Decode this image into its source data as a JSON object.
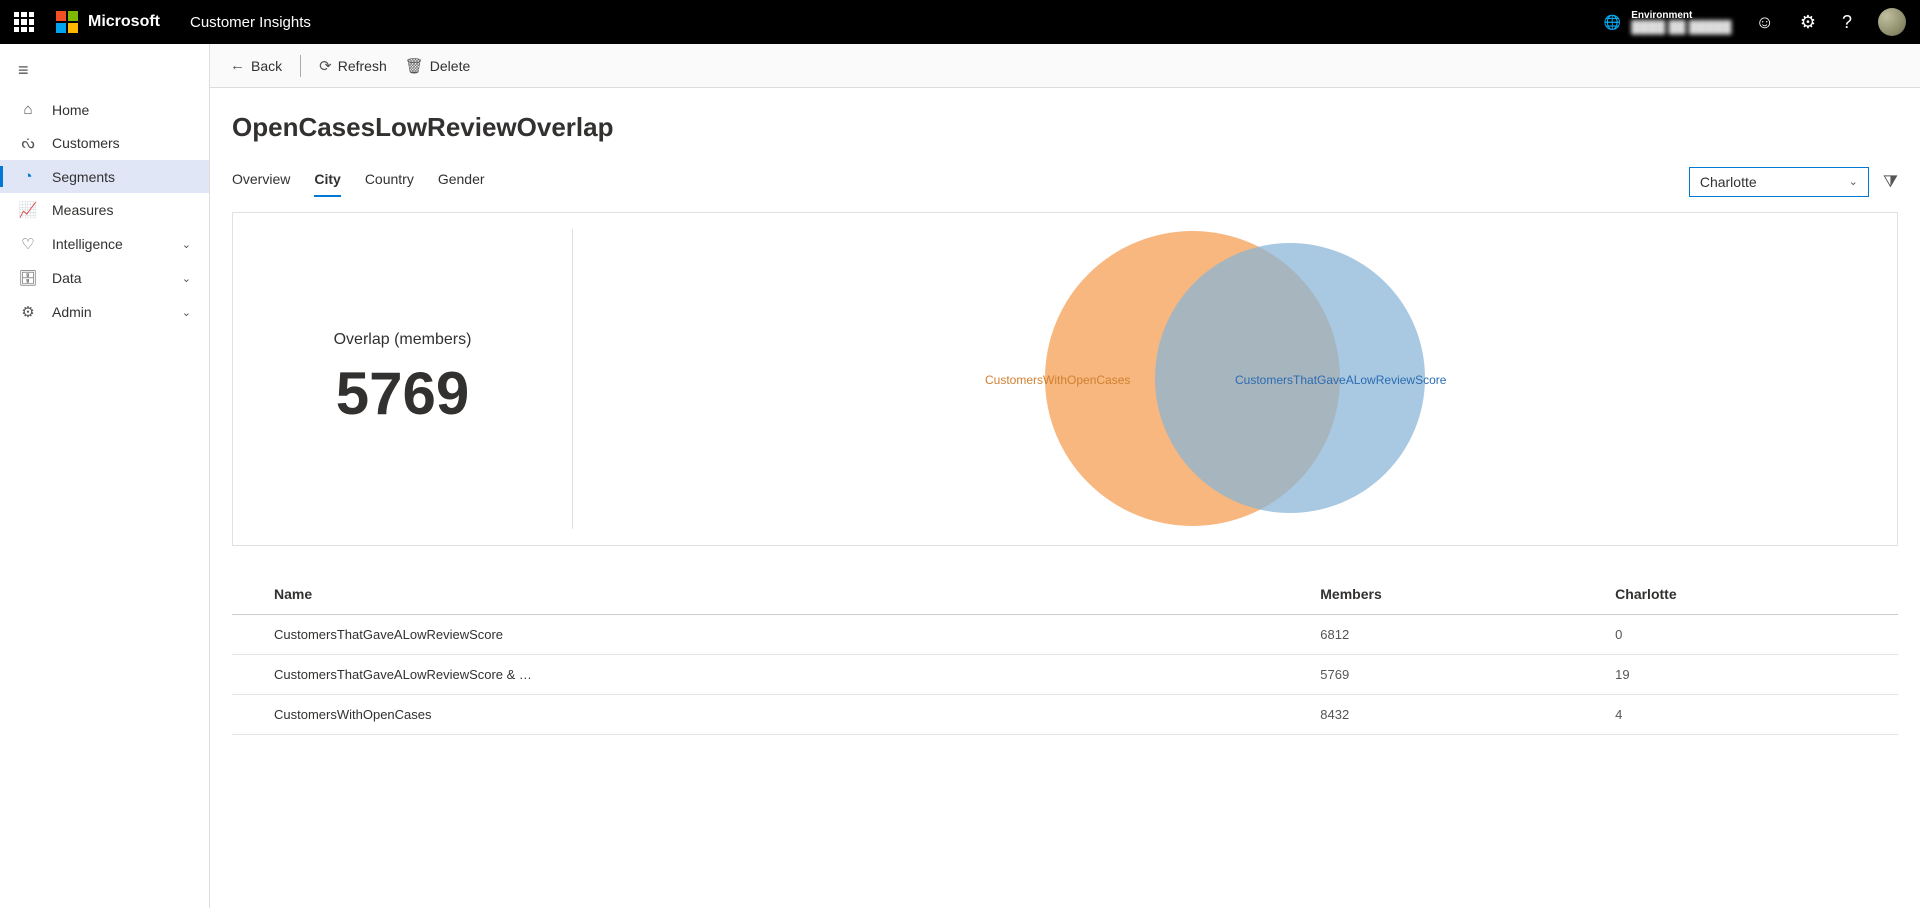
{
  "header": {
    "brand": "Microsoft",
    "suite": "Customer Insights",
    "env_label": "Environment",
    "env_value": "████ ██ █████"
  },
  "sidebar": {
    "items": [
      {
        "icon": "⌂",
        "label": "Home"
      },
      {
        "icon": "ᔔ",
        "label": "Customers"
      },
      {
        "icon": "◔",
        "label": "Segments",
        "active": true
      },
      {
        "icon": "📈",
        "label": "Measures"
      },
      {
        "icon": "♡",
        "label": "Intelligence",
        "expandable": true
      },
      {
        "icon": "🗄",
        "label": "Data",
        "expandable": true
      },
      {
        "icon": "⚙",
        "label": "Admin",
        "expandable": true
      }
    ]
  },
  "toolbar": {
    "back": "Back",
    "refresh": "Refresh",
    "del": "Delete"
  },
  "page": {
    "title": "OpenCasesLowReviewOverlap",
    "tabs": [
      "Overview",
      "City",
      "Country",
      "Gender"
    ],
    "active_tab": 1,
    "dropdown_selected": "Charlotte"
  },
  "stat": {
    "label": "Overlap (members)",
    "value": "5769"
  },
  "venn": {
    "labelA": "CustomersWithOpenCases",
    "labelB": "CustomersThatGaveALowReviewScore"
  },
  "table": {
    "columns": [
      "Name",
      "Members",
      "Charlotte"
    ],
    "rows": [
      {
        "name": "CustomersThatGaveALowReviewScore",
        "members": "6812",
        "c": "0"
      },
      {
        "name": "CustomersThatGaveALowReviewScore & …",
        "members": "5769",
        "c": "19"
      },
      {
        "name": "CustomersWithOpenCases",
        "members": "8432",
        "c": "4"
      }
    ]
  },
  "chart_data": {
    "type": "venn",
    "title": "OpenCasesLowReviewOverlap — City: Charlotte",
    "sets": [
      {
        "name": "CustomersWithOpenCases",
        "size": 8432,
        "color": "#f5a35b"
      },
      {
        "name": "CustomersThatGaveALowReviewScore",
        "size": 6812,
        "color": "#88b4d8"
      }
    ],
    "intersections": [
      {
        "sets": [
          "CustomersWithOpenCases",
          "CustomersThatGaveALowReviewScore"
        ],
        "size": 5769
      }
    ],
    "facet": "Charlotte",
    "facet_values": {
      "CustomersThatGaveALowReviewScore": 0,
      "CustomersThatGaveALowReviewScore & CustomersWithOpenCases": 19,
      "CustomersWithOpenCases": 4
    }
  }
}
